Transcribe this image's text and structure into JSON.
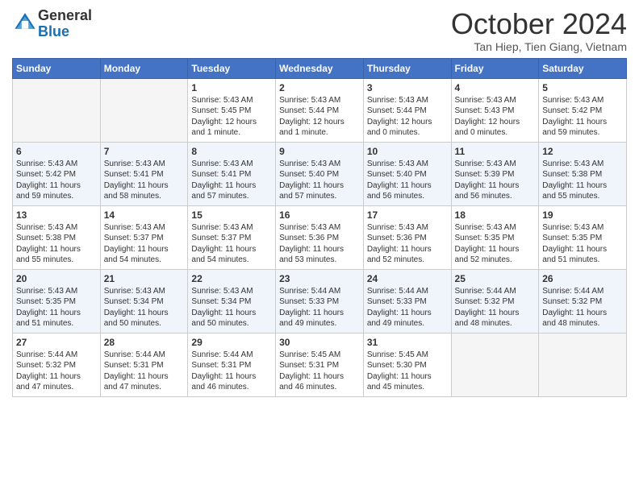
{
  "header": {
    "logo_general": "General",
    "logo_blue": "Blue",
    "month_title": "October 2024",
    "subtitle": "Tan Hiep, Tien Giang, Vietnam"
  },
  "weekdays": [
    "Sunday",
    "Monday",
    "Tuesday",
    "Wednesday",
    "Thursday",
    "Friday",
    "Saturday"
  ],
  "weeks": [
    [
      {
        "day": "",
        "info": ""
      },
      {
        "day": "",
        "info": ""
      },
      {
        "day": "1",
        "info": "Sunrise: 5:43 AM\nSunset: 5:45 PM\nDaylight: 12 hours\nand 1 minute."
      },
      {
        "day": "2",
        "info": "Sunrise: 5:43 AM\nSunset: 5:44 PM\nDaylight: 12 hours\nand 1 minute."
      },
      {
        "day": "3",
        "info": "Sunrise: 5:43 AM\nSunset: 5:44 PM\nDaylight: 12 hours\nand 0 minutes."
      },
      {
        "day": "4",
        "info": "Sunrise: 5:43 AM\nSunset: 5:43 PM\nDaylight: 12 hours\nand 0 minutes."
      },
      {
        "day": "5",
        "info": "Sunrise: 5:43 AM\nSunset: 5:42 PM\nDaylight: 11 hours\nand 59 minutes."
      }
    ],
    [
      {
        "day": "6",
        "info": "Sunrise: 5:43 AM\nSunset: 5:42 PM\nDaylight: 11 hours\nand 59 minutes."
      },
      {
        "day": "7",
        "info": "Sunrise: 5:43 AM\nSunset: 5:41 PM\nDaylight: 11 hours\nand 58 minutes."
      },
      {
        "day": "8",
        "info": "Sunrise: 5:43 AM\nSunset: 5:41 PM\nDaylight: 11 hours\nand 57 minutes."
      },
      {
        "day": "9",
        "info": "Sunrise: 5:43 AM\nSunset: 5:40 PM\nDaylight: 11 hours\nand 57 minutes."
      },
      {
        "day": "10",
        "info": "Sunrise: 5:43 AM\nSunset: 5:40 PM\nDaylight: 11 hours\nand 56 minutes."
      },
      {
        "day": "11",
        "info": "Sunrise: 5:43 AM\nSunset: 5:39 PM\nDaylight: 11 hours\nand 56 minutes."
      },
      {
        "day": "12",
        "info": "Sunrise: 5:43 AM\nSunset: 5:38 PM\nDaylight: 11 hours\nand 55 minutes."
      }
    ],
    [
      {
        "day": "13",
        "info": "Sunrise: 5:43 AM\nSunset: 5:38 PM\nDaylight: 11 hours\nand 55 minutes."
      },
      {
        "day": "14",
        "info": "Sunrise: 5:43 AM\nSunset: 5:37 PM\nDaylight: 11 hours\nand 54 minutes."
      },
      {
        "day": "15",
        "info": "Sunrise: 5:43 AM\nSunset: 5:37 PM\nDaylight: 11 hours\nand 54 minutes."
      },
      {
        "day": "16",
        "info": "Sunrise: 5:43 AM\nSunset: 5:36 PM\nDaylight: 11 hours\nand 53 minutes."
      },
      {
        "day": "17",
        "info": "Sunrise: 5:43 AM\nSunset: 5:36 PM\nDaylight: 11 hours\nand 52 minutes."
      },
      {
        "day": "18",
        "info": "Sunrise: 5:43 AM\nSunset: 5:35 PM\nDaylight: 11 hours\nand 52 minutes."
      },
      {
        "day": "19",
        "info": "Sunrise: 5:43 AM\nSunset: 5:35 PM\nDaylight: 11 hours\nand 51 minutes."
      }
    ],
    [
      {
        "day": "20",
        "info": "Sunrise: 5:43 AM\nSunset: 5:35 PM\nDaylight: 11 hours\nand 51 minutes."
      },
      {
        "day": "21",
        "info": "Sunrise: 5:43 AM\nSunset: 5:34 PM\nDaylight: 11 hours\nand 50 minutes."
      },
      {
        "day": "22",
        "info": "Sunrise: 5:43 AM\nSunset: 5:34 PM\nDaylight: 11 hours\nand 50 minutes."
      },
      {
        "day": "23",
        "info": "Sunrise: 5:44 AM\nSunset: 5:33 PM\nDaylight: 11 hours\nand 49 minutes."
      },
      {
        "day": "24",
        "info": "Sunrise: 5:44 AM\nSunset: 5:33 PM\nDaylight: 11 hours\nand 49 minutes."
      },
      {
        "day": "25",
        "info": "Sunrise: 5:44 AM\nSunset: 5:32 PM\nDaylight: 11 hours\nand 48 minutes."
      },
      {
        "day": "26",
        "info": "Sunrise: 5:44 AM\nSunset: 5:32 PM\nDaylight: 11 hours\nand 48 minutes."
      }
    ],
    [
      {
        "day": "27",
        "info": "Sunrise: 5:44 AM\nSunset: 5:32 PM\nDaylight: 11 hours\nand 47 minutes."
      },
      {
        "day": "28",
        "info": "Sunrise: 5:44 AM\nSunset: 5:31 PM\nDaylight: 11 hours\nand 47 minutes."
      },
      {
        "day": "29",
        "info": "Sunrise: 5:44 AM\nSunset: 5:31 PM\nDaylight: 11 hours\nand 46 minutes."
      },
      {
        "day": "30",
        "info": "Sunrise: 5:45 AM\nSunset: 5:31 PM\nDaylight: 11 hours\nand 46 minutes."
      },
      {
        "day": "31",
        "info": "Sunrise: 5:45 AM\nSunset: 5:30 PM\nDaylight: 11 hours\nand 45 minutes."
      },
      {
        "day": "",
        "info": ""
      },
      {
        "day": "",
        "info": ""
      }
    ]
  ]
}
